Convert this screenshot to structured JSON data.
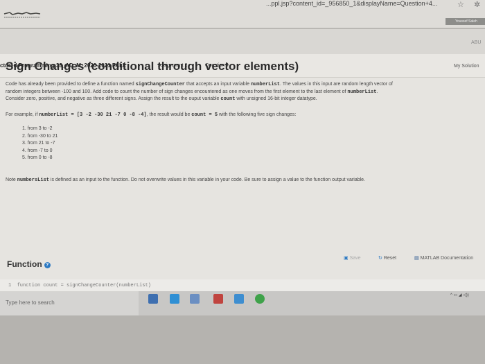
{
  "browser": {
    "url_fragment": "...ppl.jsp?content_id=_956850_1&displayName=Question+4...",
    "profile_label": "Youssef Saleh"
  },
  "breadcrumb": {
    "course": "ctured Programming 33_AD_M_2020-2021 FALL",
    "separator": "...",
    "assignment": "Assignment 2",
    "question": "Question 4"
  },
  "page_corner": "ABU",
  "problem": {
    "title": "Sign Changes (conditional through vector elements)",
    "my_solution": "My Solution",
    "description": {
      "l1_a": "Code has already been provided to define a function named ",
      "l1_fn": "signChangeCounter",
      "l1_b": " that accepts an input variable ",
      "l1_var": "numberList",
      "l1_c": ". The values in this input are random length vector of",
      "l2_a": "random integers between -100 and 100. Add code to count the number of sign changes encountered as one moves from the first element to the last element of ",
      "l2_var": "numberList",
      "l2_b": ".",
      "l3_a": "Consider zero, positive, and negative as three different signs. Assign the result to the ouput variable ",
      "l3_var": "count",
      "l3_b": " with unsigned 16-bit integer datatype."
    },
    "example": {
      "a": "For example, if ",
      "code1": "numberList = [3 -2 -30 21 -7 0 -8 -4]",
      "b": ", the result would be ",
      "code2": "count = 5",
      "c": " with the following five sign changes:"
    },
    "steps": [
      "1. from 3 to -2",
      "2. from -30 to 21",
      "3. from 21 to -7",
      "4. from -7 to 0",
      "5. from 0 to -8"
    ],
    "note": {
      "a": "Note ",
      "var": "numbersList",
      "b": " is defined as an input to the function. Do not overwrite values in this variable in your code. Be sure to assign a value to the function output variable."
    }
  },
  "function_panel": {
    "title": "Function",
    "help_icon": "?",
    "save_label": "Save",
    "reset_label": "Reset",
    "docs_label": "MATLAB Documentation",
    "code_line_number": "1",
    "code_line": "function count = signChangeCounter(numberList)"
  },
  "taskbar": {
    "search_placeholder": "Type here to search"
  },
  "colors": {
    "accent_blue": "#2a78c2",
    "page_bg": "#e6e4e0"
  }
}
